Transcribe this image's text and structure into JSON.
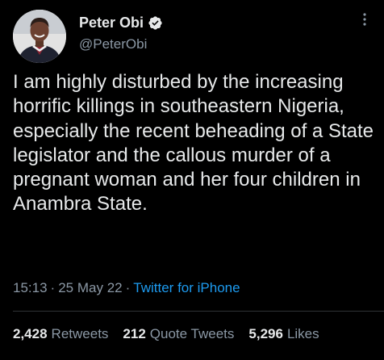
{
  "author": {
    "display_name": "Peter Obi",
    "handle": "@PeterObi",
    "verified_badge_icon": "verified-badge-icon",
    "verified_color": "#1d9bf0"
  },
  "tweet": {
    "text": "I am highly disturbed by the increasing horrific killings in southeastern Nigeria, especially the recent beheading of a State legislator and the callous murder of a pregnant woman and her four children in Anambra State."
  },
  "meta": {
    "time": "15:13",
    "separator": "·",
    "date": "25 May 22",
    "source": "Twitter for iPhone"
  },
  "stats": {
    "retweets_count": "2,428",
    "retweets_label": "Retweets",
    "quote_tweets_count": "212",
    "quote_tweets_label": "Quote Tweets",
    "likes_count": "5,296",
    "likes_label": "Likes"
  },
  "colors": {
    "background": "#000000",
    "primary_text": "#e7e9ea",
    "secondary_text": "#8b98a5",
    "accent": "#1d9bf0",
    "divider": "#2f3336"
  },
  "icons": {
    "more": "more-options-icon",
    "avatar": "profile-avatar"
  }
}
